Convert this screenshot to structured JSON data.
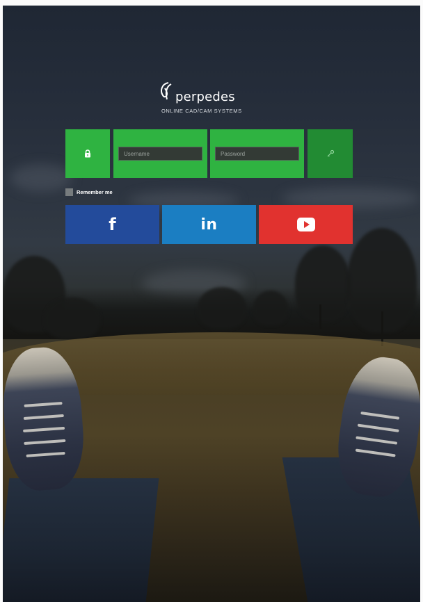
{
  "brand": {
    "name": "perpedes",
    "tagline": "ONLINE CAD/CAM SYSTEMS"
  },
  "login": {
    "username_placeholder": "Username",
    "password_placeholder": "Password",
    "remember_label": "Remember me",
    "lock_icon": "lock-icon",
    "submit_icon": "key-icon"
  },
  "social": {
    "facebook_label": "f",
    "linkedin_label": "in",
    "youtube_icon": "youtube-play-icon"
  },
  "colors": {
    "tile_green": "#2fb341",
    "submit_green": "#228b33",
    "facebook_blue": "#234b9b",
    "linkedin_blue": "#1b7ec2",
    "youtube_red": "#e1322f"
  }
}
